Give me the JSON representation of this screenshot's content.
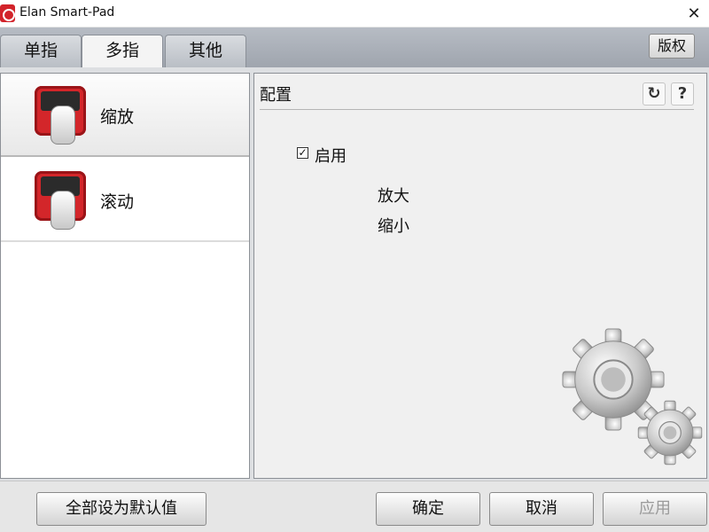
{
  "window": {
    "title": "Elan Smart-Pad",
    "close_glyph": "✕",
    "app_icon": "elan-logo-icon"
  },
  "tabs": [
    {
      "label": "单指",
      "active": false
    },
    {
      "label": "多指",
      "active": true
    },
    {
      "label": "其他",
      "active": false
    }
  ],
  "header": {
    "copyright_label": "版权"
  },
  "gestures": [
    {
      "label": "缩放",
      "icon": "pinch-zoom-gesture-icon",
      "selected": true
    },
    {
      "label": "滚动",
      "icon": "scroll-gesture-icon",
      "selected": false
    }
  ],
  "config": {
    "title": "配置",
    "refresh_glyph": "↻",
    "help_glyph": "?",
    "enable_checked": true,
    "enable_check_glyph": "✓",
    "enable_label": "启用",
    "option_zoom_in": "放大",
    "option_zoom_out": "缩小"
  },
  "buttons": {
    "defaults": "全部设为默认值",
    "ok": "确定",
    "cancel": "取消",
    "apply": "应用"
  },
  "colors": {
    "accent_red": "#d3262a",
    "tab_bar": "#a9aeb6",
    "panel_bg": "#f0f0f0"
  }
}
